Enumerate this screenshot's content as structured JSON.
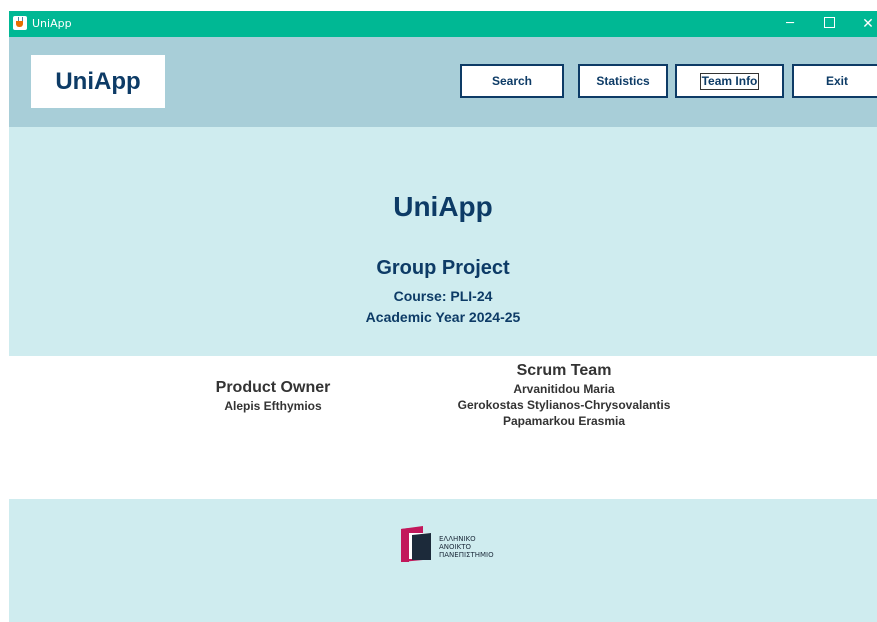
{
  "window": {
    "title": "UniApp",
    "controls": {
      "minimize": "─",
      "close": "✕"
    }
  },
  "header": {
    "logo": "UniApp",
    "buttons": {
      "search": "Search",
      "statistics": "Statistics",
      "team_info": "Team Info",
      "exit": "Exit"
    }
  },
  "hero": {
    "title": "UniApp",
    "project": "Group Project",
    "course": "Course: PLI-24",
    "year": "Academic Year 2024-25"
  },
  "team": {
    "product_owner_title": "Product Owner",
    "product_owner_name": "Alepis Efthymios",
    "scrum_title": "Scrum Team",
    "scrum_members": [
      "Arvanitidou Maria",
      "Gerokostas Stylianos-Chrysovalantis",
      "Papamarkou Erasmia"
    ]
  },
  "footer": {
    "university_logo_lines": [
      "ΕΛΛΗΝΙΚΟ",
      "ΑΝΟΙΚΤΟ",
      "ΠΑΝΕΠΙΣΤΗΜΙΟ"
    ]
  },
  "colors": {
    "titlebar": "#00b894",
    "header_bg": "#a8ced8",
    "hero_bg": "#cfecef",
    "primary": "#0d3b66",
    "logo_magenta": "#c2185b"
  }
}
